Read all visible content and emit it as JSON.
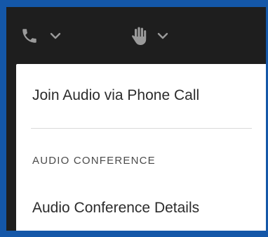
{
  "toolbar": {
    "audio_icon": "phone-icon",
    "audio_dropdown_icon": "chevron-down-icon",
    "raise_hand_icon": "hand-icon",
    "raise_hand_dropdown_icon": "chevron-down-icon",
    "icon_color": "#9a9a9a"
  },
  "menu": {
    "join_audio_label": "Join Audio via Phone Call",
    "section_header": "AUDIO CONFERENCE",
    "details_label": "Audio Conference Details"
  },
  "colors": {
    "background": "#1457a8",
    "toolbar": "#1e1e1e",
    "menu_bg": "#ffffff",
    "menu_text": "#2c2c2c"
  }
}
